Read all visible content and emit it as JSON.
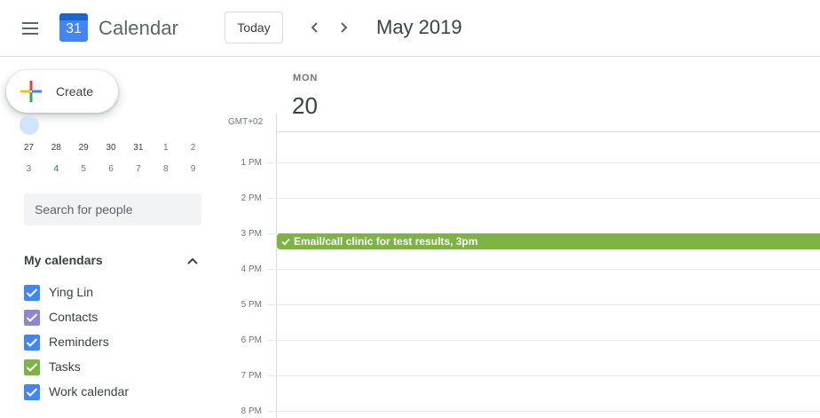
{
  "header": {
    "app_title": "Calendar",
    "logo_day": "31",
    "today_label": "Today",
    "period": "May 2019"
  },
  "sidebar": {
    "create_label": "Create",
    "mini_calendar": {
      "rows": [
        [
          "27",
          "28",
          "29",
          "30",
          "31",
          "1",
          "2"
        ],
        [
          "3",
          "4",
          "5",
          "6",
          "7",
          "8",
          "9"
        ]
      ]
    },
    "search_placeholder": "Search for people",
    "my_calendars_title": "My calendars",
    "calendars": [
      {
        "name": "Ying Lin",
        "color": "#4285f4",
        "checked": true
      },
      {
        "name": "Contacts",
        "color": "#8e86d3",
        "checked": true
      },
      {
        "name": "Reminders",
        "color": "#4285f4",
        "checked": true
      },
      {
        "name": "Tasks",
        "color": "#7cb342",
        "checked": true
      },
      {
        "name": "Work calendar",
        "color": "#4285f4",
        "checked": true
      }
    ]
  },
  "day_view": {
    "day_name": "MON",
    "day_number": "20",
    "timezone": "GMT+02",
    "hours": [
      "1 PM",
      "2 PM",
      "3 PM",
      "4 PM",
      "5 PM",
      "6 PM",
      "7 PM",
      "8 PM"
    ],
    "event": {
      "title": "Email/call clinic for test results, 3pm",
      "color": "#7cb342"
    }
  },
  "colors": {
    "accent": "#1a73e8",
    "border": "#dadce0",
    "text": "#3c4043",
    "muted": "#70757a"
  }
}
